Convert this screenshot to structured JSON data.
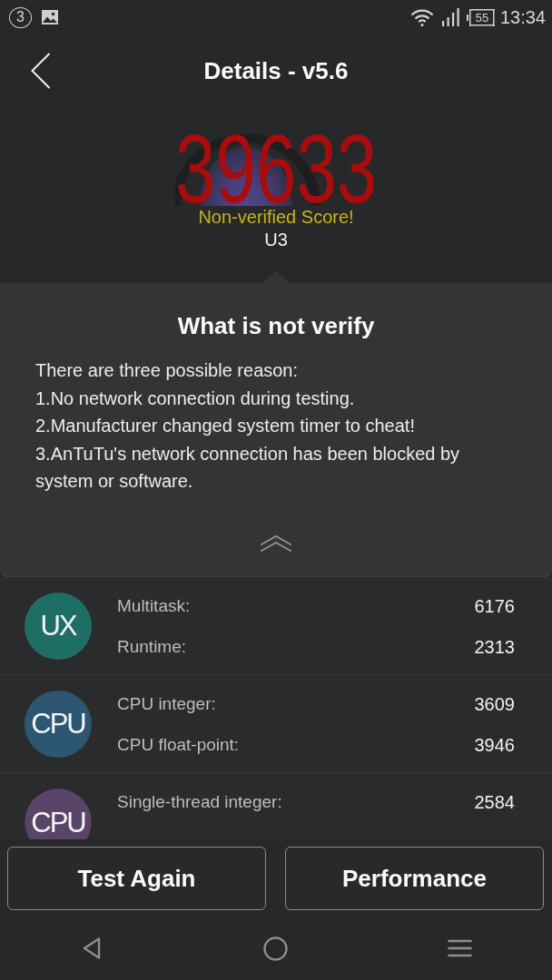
{
  "status_bar": {
    "notification_count": "3",
    "battery": "55",
    "time": "13:34"
  },
  "header": {
    "title": "Details - v5.6"
  },
  "score": {
    "value": "39633",
    "note": "Non-verified Score!",
    "device": "U3"
  },
  "info_panel": {
    "title": "What is not verify",
    "lines": [
      "There are three possible reason:",
      "1.No network connection during testing.",
      "2.Manufacturer changed system timer to cheat!",
      "3.AnTuTu's network connection has been blocked by system or software."
    ]
  },
  "results": [
    {
      "badge": "UX",
      "color": "#1f6e66",
      "items": [
        {
          "label": "Multitask:",
          "value": "6176"
        },
        {
          "label": "Runtime:",
          "value": "2313"
        }
      ]
    },
    {
      "badge": "CPU",
      "color": "#2d5672",
      "items": [
        {
          "label": "CPU integer:",
          "value": "3609"
        },
        {
          "label": "CPU float-point:",
          "value": "3946"
        }
      ]
    },
    {
      "badge": "CPU",
      "color": "#5b4469",
      "items": [
        {
          "label": "Single-thread integer:",
          "value": "2584"
        }
      ]
    }
  ],
  "buttons": [
    "Test Again",
    "Performance"
  ]
}
